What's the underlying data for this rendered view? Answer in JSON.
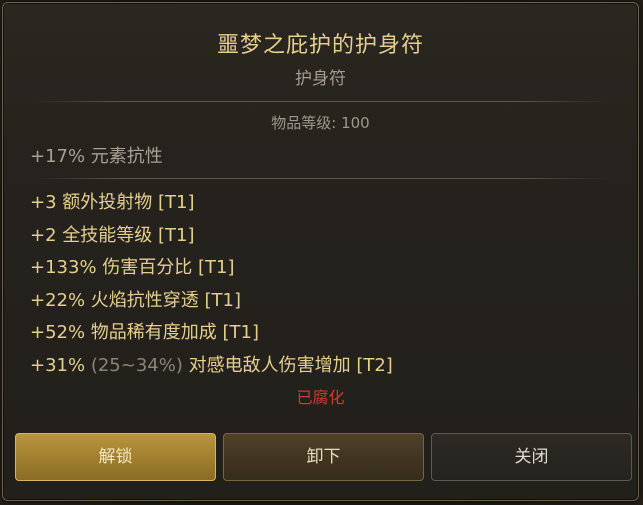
{
  "item": {
    "name": "噩梦之庇护的护身符",
    "type": "护身符",
    "level_text": "物品等级: 100",
    "implicit": "+17% 元素抗性",
    "mods": [
      {
        "text": "+3 额外投射物 [T1]"
      },
      {
        "text": "+2 全技能等级 [T1]"
      },
      {
        "text": "+133% 伤害百分比 [T1]"
      },
      {
        "text": "+22% 火焰抗性穿透 [T1]"
      },
      {
        "text": "+52% 物品稀有度加成 [T1]"
      },
      {
        "value": "+31%",
        "range": "(25~34%)",
        "desc": "对感电敌人伤害增加 [T2]"
      }
    ],
    "status": "已腐化"
  },
  "buttons": {
    "unlock": "解锁",
    "unequip": "卸下",
    "close": "关闭"
  },
  "colors": {
    "accent_gold": "#e6cf8e",
    "corrupted_red": "#d23a2e",
    "muted_text": "#a8a092"
  }
}
